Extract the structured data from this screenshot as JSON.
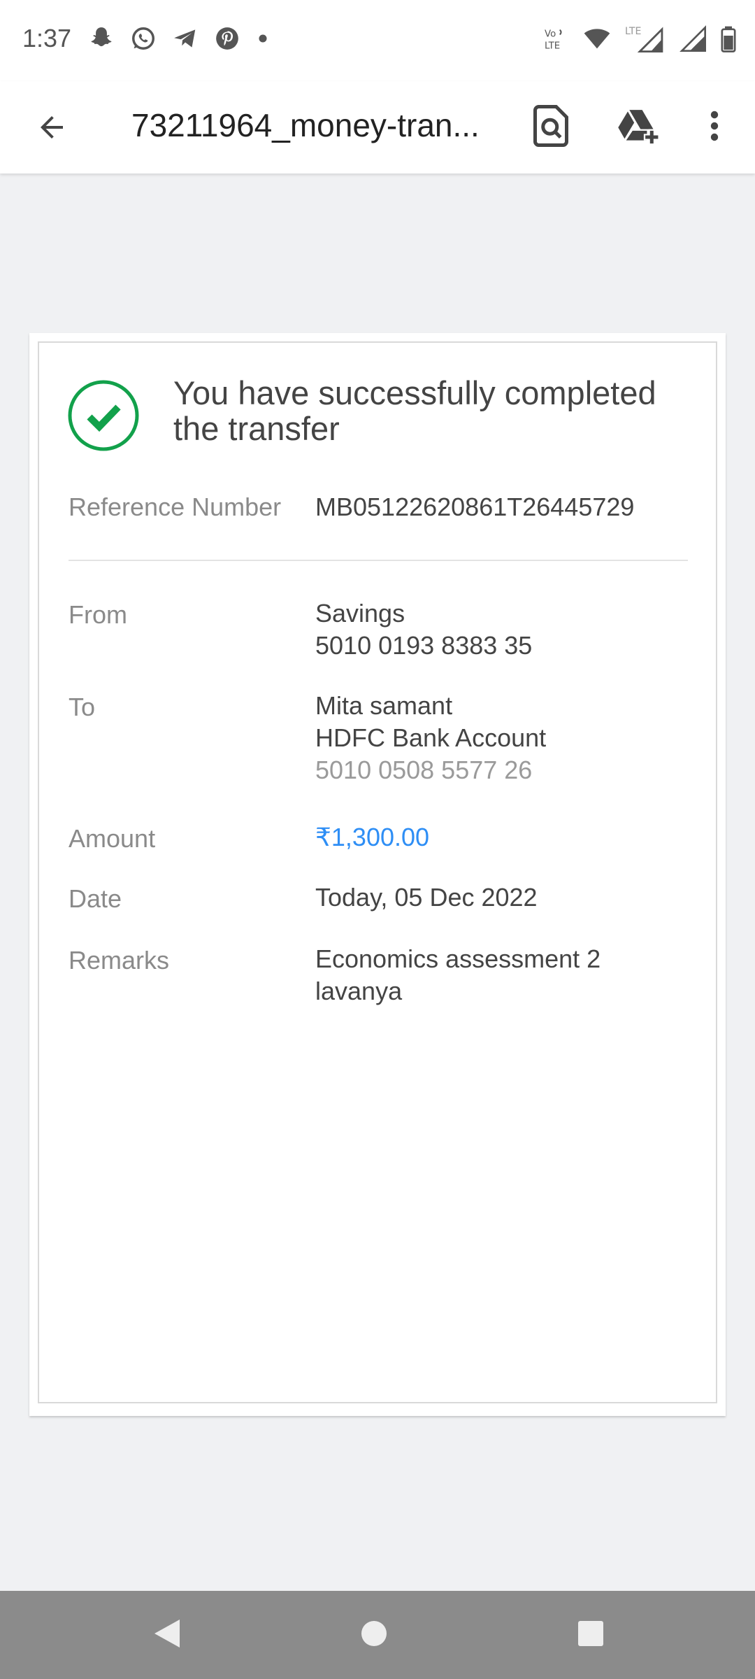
{
  "status_bar": {
    "time": "1:37",
    "left_icons": [
      "snapchat-icon",
      "whatsapp-icon",
      "telegram-icon",
      "pinterest-icon",
      "dot-icon"
    ],
    "right_icons": [
      "volte-icon",
      "wifi-icon",
      "lte-signal-icon",
      "signal-icon",
      "battery-icon"
    ],
    "volte_text": "Vo LTE",
    "lte_text": "LTE"
  },
  "app_bar": {
    "title": "73211964_money-tran...",
    "icons": [
      "back-arrow-icon",
      "search-document-icon",
      "drive-add-icon",
      "more-vert-icon"
    ]
  },
  "receipt": {
    "title": "You have successfully completed the transfer",
    "reference": {
      "label": "Reference Number",
      "value": "MB05122620861T26445729"
    },
    "from": {
      "label": "From",
      "line1": "Savings",
      "line2": "5010 0193 8383 35"
    },
    "to": {
      "label": "To",
      "line1": "Mita samant",
      "line2": "HDFC Bank Account",
      "line3": "5010 0508 5577 26"
    },
    "amount": {
      "label": "Amount",
      "value": "₹1,300.00"
    },
    "date": {
      "label": "Date",
      "value": "Today, 05 Dec 2022"
    },
    "remarks": {
      "label": "Remarks",
      "line1": "Economics assessment 2",
      "line2": "lavanya"
    }
  },
  "colors": {
    "success_green": "#12a14b",
    "amount_blue": "#2e8ef5",
    "background": "#f0f1f3",
    "nav_bar": "#8b8b8b"
  },
  "nav_bar": {
    "icons": [
      "nav-back-icon",
      "nav-home-icon",
      "nav-recents-icon"
    ]
  }
}
